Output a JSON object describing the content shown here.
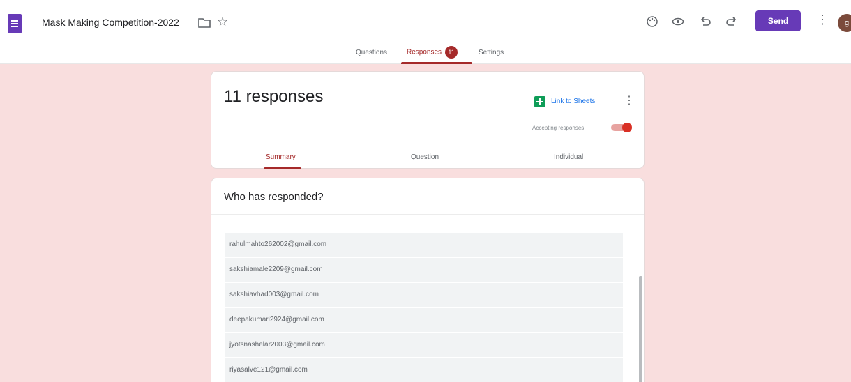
{
  "app": {
    "title": "Mask Making Competition-2022"
  },
  "toolbar": {
    "send_label": "Send",
    "avatar_initial": "g",
    "icons": [
      "palette-icon",
      "preview-eye-icon",
      "undo-icon",
      "redo-icon",
      "more-vert-icon"
    ]
  },
  "tabs": [
    {
      "label": "Questions",
      "active": false
    },
    {
      "label": "Responses",
      "active": true,
      "badge": "11"
    },
    {
      "label": "Settings",
      "active": false
    }
  ],
  "responses": {
    "count_label": "11 responses",
    "link_to_sheets": "Link to Sheets",
    "accepting_label": "Accepting responses",
    "accepting": true
  },
  "subtabs": [
    {
      "label": "Summary",
      "active": true
    },
    {
      "label": "Question",
      "active": false
    },
    {
      "label": "Individual",
      "active": false
    }
  ],
  "who": {
    "title": "Who has responded?",
    "emails": [
      "rahulmahto262002@gmail.com",
      "sakshiamale2209@gmail.com",
      "sakshiavhad003@gmail.com",
      "deepakumari2924@gmail.com",
      "jyotsnashelar2003@gmail.com",
      "riyasalve121@gmail.com"
    ]
  },
  "colors": {
    "accent": "#673ab7",
    "tab_active": "#a52a2a",
    "background": "#f9dede",
    "sheets": "#0f9d58"
  }
}
